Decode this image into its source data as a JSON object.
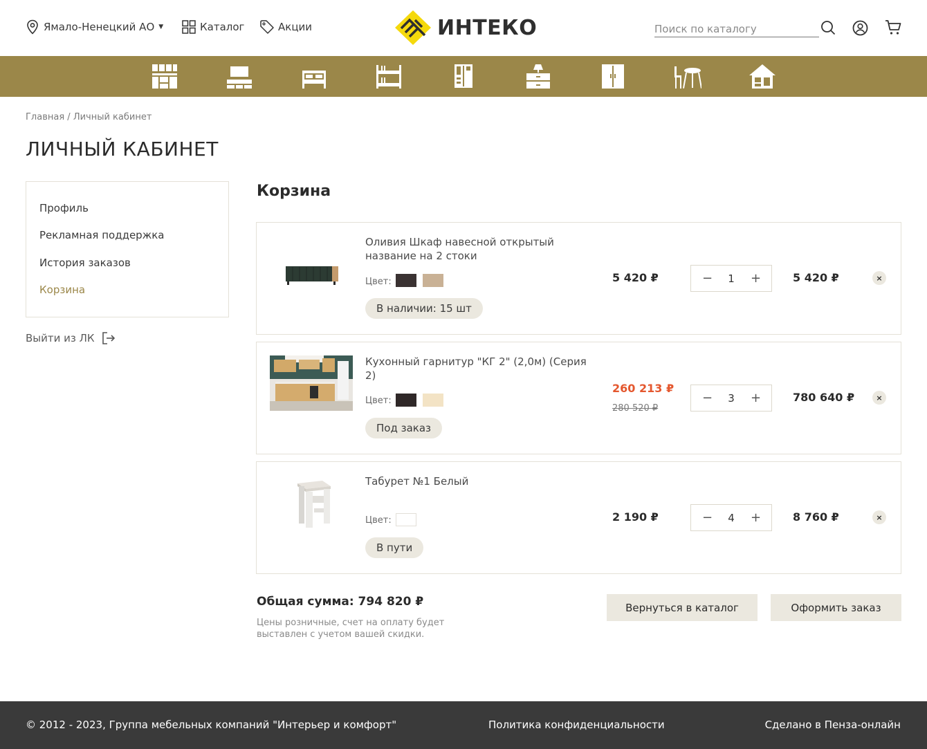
{
  "header": {
    "region": "Ямало-Ненецкий АО",
    "catalog": "Каталог",
    "promo": "Акции",
    "logo": "ИНТЕКО",
    "search_placeholder": "Поиск по каталогу"
  },
  "category_icons": [
    "kitchen-icon",
    "tv-stand-icon",
    "bed-icon",
    "bunk-bed-icon",
    "wardrobe-icon",
    "nightstand-icon",
    "closet-icon",
    "table-chairs-icon",
    "house-icon"
  ],
  "breadcrumb": {
    "home": "Главная",
    "separator": " / ",
    "current": "Личный кабинет"
  },
  "page_title": "ЛИЧНЫЙ КАБИНЕТ",
  "sidebar": {
    "items": [
      {
        "label": "Профиль",
        "active": false
      },
      {
        "label": "Рекламная поддержка",
        "active": false
      },
      {
        "label": "История заказов",
        "active": false
      },
      {
        "label": "Корзина",
        "active": true
      }
    ],
    "logout": "Выйти из ЛК"
  },
  "cart": {
    "title": "Корзина",
    "color_label": "Цвет:",
    "items": [
      {
        "name": "Оливия Шкаф навесной открытый название на 2 стоки",
        "colors": [
          "#3a3232",
          "#c9b195"
        ],
        "status": "В наличии: 15 шт",
        "price": "5 420 ₽",
        "old_price": null,
        "qty": "1",
        "total": "5 420 ₽"
      },
      {
        "name": "Кухонный гарнитур \"КГ 2\" (2,0м) (Серия 2)",
        "colors": [
          "#2f2828",
          "#f3e3c5"
        ],
        "status": "Под заказ",
        "price": "260 213 ₽",
        "old_price": "280 520 ₽",
        "qty": "3",
        "total": "780 640 ₽"
      },
      {
        "name": "Табурет №1 Белый",
        "colors": [
          "#ffffff"
        ],
        "status": "В пути",
        "price": "2 190 ₽",
        "old_price": null,
        "qty": "4",
        "total": "8 760 ₽"
      }
    ],
    "qty_minus": "−",
    "qty_plus": "+",
    "remove": "×",
    "sum_label": "Общая сумма: 794 820 ₽",
    "note": "Цены розничные, счет на оплату будет выставлен с учетом вашей скидки.",
    "back_button": "Вернуться в каталог",
    "order_button": "Оформить заказ"
  },
  "footer": {
    "copyright": "© 2012 - 2023, Группа мебельных компаний \"Интерьер и комфорт\"",
    "policy": "Политика конфиденциальности",
    "made_by": "Сделано в Пенза-онлайн"
  },
  "colors": {
    "accent": "#9b8749",
    "sale": "#e4572e",
    "footer_bg": "#3a3a3a",
    "badge_bg": "#ebe8df"
  }
}
